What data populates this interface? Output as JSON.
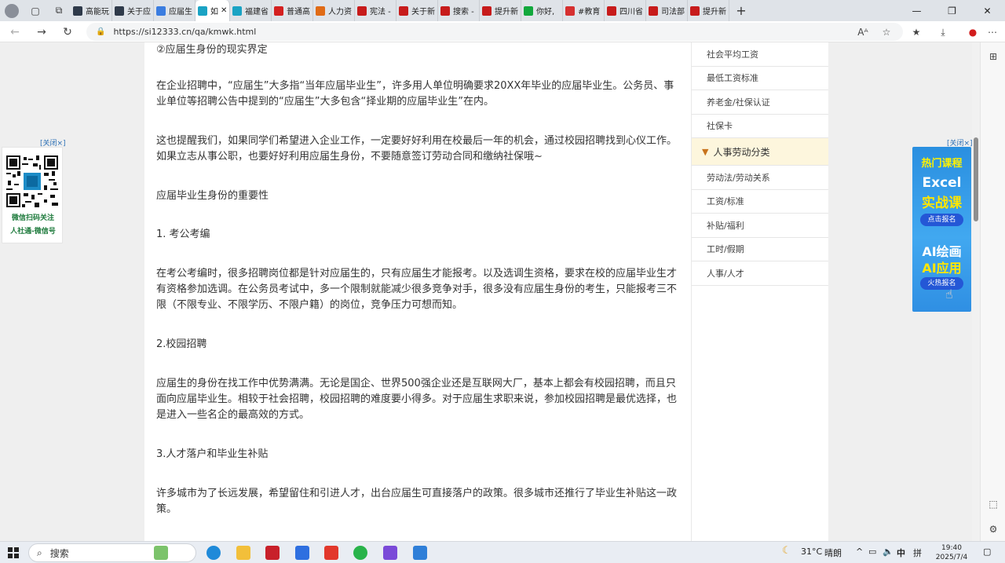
{
  "tabs": [
    {
      "label": "高能玩",
      "color": "#2f3a4a"
    },
    {
      "label": "关于应",
      "color": "#2f3a4a"
    },
    {
      "label": "应届生",
      "color": "#3b7de0"
    },
    {
      "label": "如",
      "color": "#1aa3c4"
    },
    {
      "label": "福建省",
      "color": "#1aa3c4"
    },
    {
      "label": "普通高",
      "color": "#d42020"
    },
    {
      "label": "人力资",
      "color": "#e06b16"
    },
    {
      "label": "宪法 -",
      "color": "#c71b1b"
    },
    {
      "label": "关于新",
      "color": "#c71b1b"
    },
    {
      "label": "搜索 -",
      "color": "#c71b1b"
    },
    {
      "label": "提升新",
      "color": "#c71b1b"
    },
    {
      "label": "你好,",
      "color": "#12a83c"
    },
    {
      "label": "#教育",
      "color": "#d63030"
    },
    {
      "label": "四川省",
      "color": "#c71b1b"
    },
    {
      "label": "司法部",
      "color": "#c71b1b"
    },
    {
      "label": "提升新",
      "color": "#c71b1b"
    }
  ],
  "address": {
    "url": "https://si12333.cn/qa/kmwk.html"
  },
  "article": {
    "p1": "②应届生身份的现实界定",
    "p2": "在企业招聘中，“应届生”大多指“当年应届毕业生”，许多用人单位明确要求20XX年毕业的应届毕业生。公务员、事业单位等招聘公告中提到的“应届生”大多包含“择业期的应届毕业生”在内。",
    "p3": "这也提醒我们，如果同学们希望进入企业工作，一定要好好利用在校最后一年的机会，通过校园招聘找到心仪工作。如果立志从事公职，也要好好利用应届生身份，不要随意签订劳动合同和缴纳社保哦~",
    "p4": "应届毕业生身份的重要性",
    "p5": "1. 考公考编",
    "p6": "在考公考编时，很多招聘岗位都是针对应届生的，只有应届生才能报考。以及选调生资格，要求在校的应届毕业生才有资格参加选调。在公务员考试中，多一个限制就能减少很多竞争对手，很多没有应届生身份的考生，只能报考三不限（不限专业、不限学历、不限户籍）的岗位，竞争压力可想而知。",
    "p7": "2.校园招聘",
    "p8": "应届生的身份在找工作中优势满满。无论是国企、世界500强企业还是互联网大厂，基本上都会有校园招聘，而且只面向应届毕业生。相较于社会招聘，校园招聘的难度要小得多。对于应届生求职来说，参加校园招聘是最优选择，也是进入一些名企的最高效的方式。",
    "p9": "3.人才落户和毕业生补贴",
    "p10": "许多城市为了长远发展，希望留住和引进人才，出台应届生可直接落户的政策。很多城市还推行了毕业生补贴这一政策。"
  },
  "sidebar": {
    "top_items": [
      "社会平均工资",
      "最低工资标准",
      "养老金/社保认证",
      "社保卡"
    ],
    "category": "人事劳动分类",
    "sub_items": [
      "劳动法/劳动关系",
      "工资/标准",
      "补贴/福利",
      "工时/假期",
      "人事/人才"
    ]
  },
  "left_ad": {
    "close": "[关闭×]",
    "caption1": "微信扫码关注",
    "caption2": "人社通-微信号"
  },
  "right_ad": {
    "close": "[关闭×]",
    "hot": "热门课程",
    "line1": "Excel",
    "line2": "实战课",
    "btn1": "点击报名",
    "line3": "AI绘画",
    "line4": "AI应用",
    "btn2": "火热报名"
  },
  "taskbar": {
    "search": "搜索",
    "weather_temp": "31°C",
    "weather_desc": "晴朗",
    "ime1": "中",
    "ime2": "拼",
    "time": "19:40",
    "date": "2025/7/4"
  }
}
